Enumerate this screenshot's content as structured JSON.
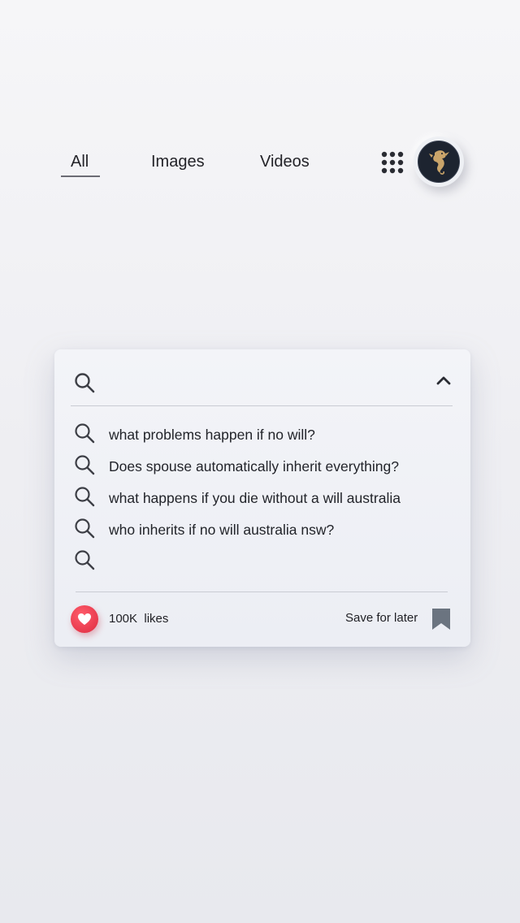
{
  "nav": {
    "tabs": [
      {
        "label": "All",
        "active": true
      },
      {
        "label": "Images",
        "active": false
      },
      {
        "label": "Videos",
        "active": false
      }
    ],
    "apps_icon": "grid-dots-icon",
    "avatar_icon": "seahorse-logo"
  },
  "search": {
    "value": "",
    "placeholder": "",
    "icon": "search-icon",
    "collapse_icon": "chevron-up-icon"
  },
  "suggestions": [
    "what problems happen if no will?",
    "Does spouse automatically inherit everything?",
    "what happens if you die without a will australia",
    "who inherits if no will australia nsw?",
    ""
  ],
  "footer": {
    "likes": "100K  likes",
    "save_label": "Save for later",
    "like_icon": "heart-icon",
    "bookmark_icon": "bookmark-icon"
  },
  "colors": {
    "accent_like": "#e83a4d",
    "bookmark": "#6b7480",
    "avatar_bg": "#1d2430",
    "logo_gold": "#c9a46a"
  }
}
